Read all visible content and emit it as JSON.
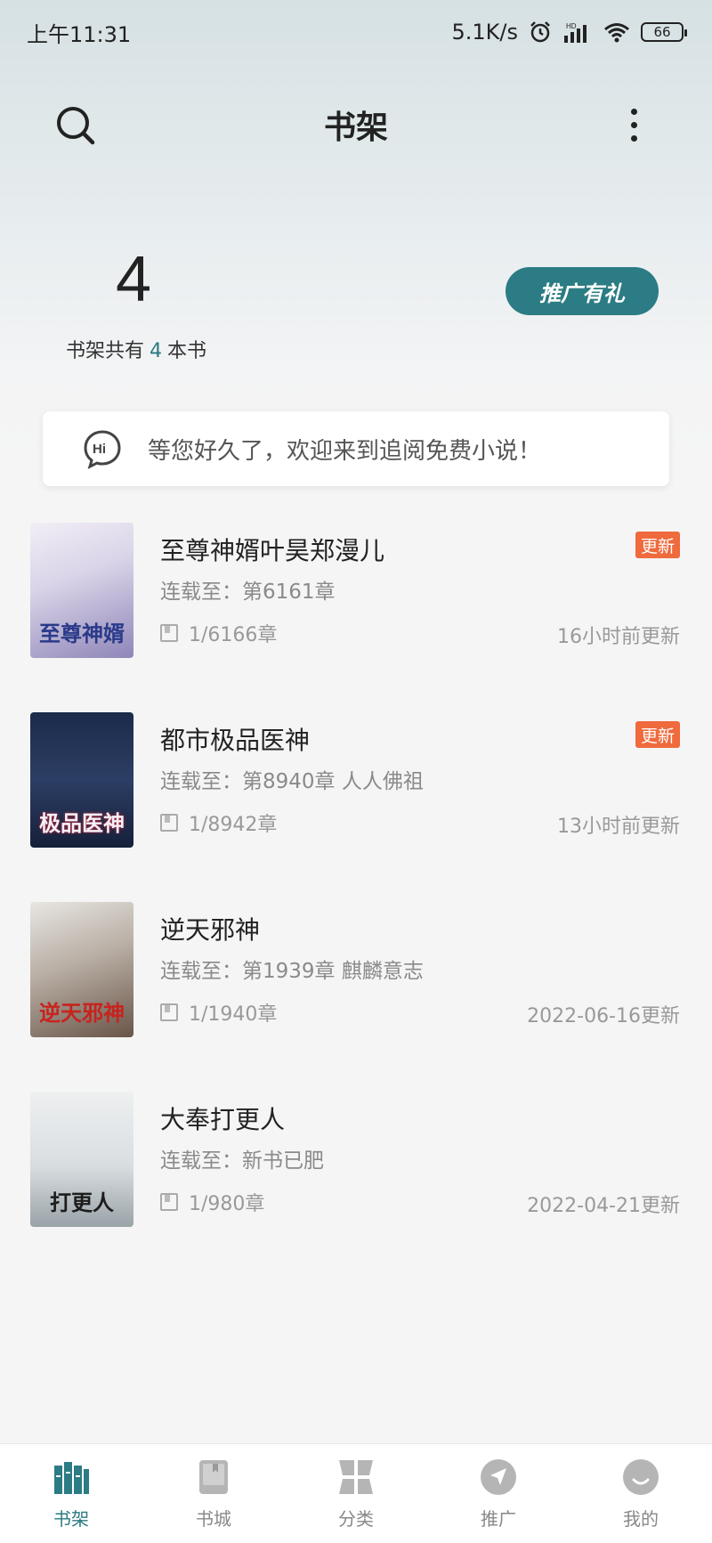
{
  "status_bar": {
    "time": "上午11:31",
    "network_speed": "5.1K/s",
    "battery": "66"
  },
  "header": {
    "title": "书架",
    "search_icon": "search-icon",
    "more_icon": "more-vertical-icon"
  },
  "stats": {
    "count": "4",
    "text_prefix": "书架共有",
    "count_inline": "4",
    "text_suffix": "本书"
  },
  "promo_button": "推广有礼",
  "greeting": {
    "icon": "hi-chat-icon",
    "text": "等您好久了，欢迎来到追阅免费小说！"
  },
  "books": [
    {
      "title": "至尊神婿叶昊郑漫儿",
      "latest": "连载至：第6161章",
      "progress": "1/6166章",
      "updated": "16小时前更新",
      "badge": "更新",
      "cover_text": "至尊神婿"
    },
    {
      "title": "都市极品医神",
      "latest": "连载至：第8940章 人人佛祖",
      "progress": "1/8942章",
      "updated": "13小时前更新",
      "badge": "更新",
      "cover_text": "极品医神"
    },
    {
      "title": "逆天邪神",
      "latest": "连载至：第1939章 麒麟意志",
      "progress": "1/1940章",
      "updated": "2022-06-16更新",
      "badge": "",
      "cover_text": "逆天邪神"
    },
    {
      "title": "大奉打更人",
      "latest": "连载至：新书已肥",
      "progress": "1/980章",
      "updated": "2022-04-21更新",
      "badge": "",
      "cover_text": "打更人"
    }
  ],
  "nav": {
    "items": [
      {
        "label": "书架",
        "icon": "bookshelf-icon",
        "active": true
      },
      {
        "label": "书城",
        "icon": "book-icon",
        "active": false
      },
      {
        "label": "分类",
        "icon": "category-grid-icon",
        "active": false
      },
      {
        "label": "推广",
        "icon": "send-icon",
        "active": false
      },
      {
        "label": "我的",
        "icon": "profile-icon",
        "active": false
      }
    ]
  },
  "colors": {
    "accent": "#2b7c84",
    "badge": "#ef6a3c"
  }
}
